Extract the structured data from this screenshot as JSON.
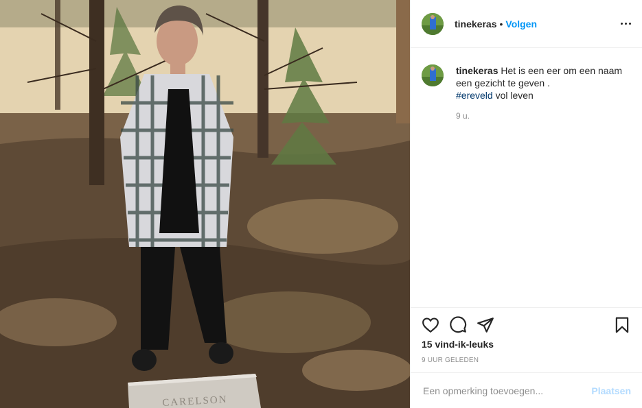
{
  "header": {
    "username": "tinekeras",
    "separator": "•",
    "follow_label": "Volgen",
    "more_icon": "more-dots-icon"
  },
  "caption": {
    "username": "tinekeras",
    "text": "Het is een eer om een naam een gezicht te geven .",
    "hashtag": "#ereveld",
    "text_after": " vol leven",
    "time": "9 u."
  },
  "actions": {
    "icons": [
      "heart-icon",
      "comment-icon",
      "share-icon",
      "bookmark-icon"
    ],
    "likes": "15 vind-ik-leuks",
    "ago": "9 UUR GELEDEN"
  },
  "comment": {
    "placeholder": "Een opmerking toevoegen...",
    "post_label": "Plaatsen"
  },
  "photo": {
    "gravestone_text": "CARELSON"
  },
  "colors": {
    "link_blue": "#0095f6",
    "hashtag": "#00376b",
    "muted": "#8e8e8e",
    "post_disabled": "#b3dbff"
  }
}
